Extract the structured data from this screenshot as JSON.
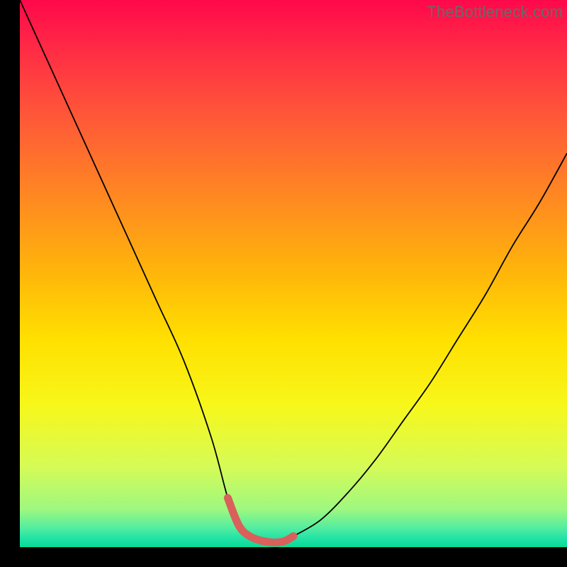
{
  "watermark": "TheBottleneck.com",
  "chart_data": {
    "type": "line",
    "title": "",
    "xlabel": "",
    "ylabel": "",
    "xlim": [
      0,
      100
    ],
    "ylim": [
      0,
      100
    ],
    "x": [
      0,
      5,
      10,
      15,
      20,
      25,
      30,
      35,
      38,
      40,
      42,
      45,
      48,
      50,
      55,
      60,
      65,
      70,
      75,
      80,
      85,
      90,
      95,
      100
    ],
    "values": [
      100,
      89,
      78,
      67,
      56,
      45,
      34,
      20,
      9,
      4,
      2,
      1,
      1,
      2,
      5,
      10,
      16,
      23,
      30,
      38,
      46,
      55,
      63,
      72
    ],
    "annotations": {
      "highlight_range_x": [
        38,
        50
      ],
      "highlight_color": "#d9605b",
      "background": "rainbow-gradient-vertical"
    }
  },
  "gradient_stops": [
    {
      "offset": 0.0,
      "color": "#ff084b"
    },
    {
      "offset": 0.1,
      "color": "#ff2f44"
    },
    {
      "offset": 0.22,
      "color": "#ff5a37"
    },
    {
      "offset": 0.35,
      "color": "#ff8523"
    },
    {
      "offset": 0.5,
      "color": "#ffb60a"
    },
    {
      "offset": 0.62,
      "color": "#ffe000"
    },
    {
      "offset": 0.74,
      "color": "#f7f71a"
    },
    {
      "offset": 0.85,
      "color": "#d7fb55"
    },
    {
      "offset": 0.93,
      "color": "#9ff87f"
    },
    {
      "offset": 0.965,
      "color": "#53eda0"
    },
    {
      "offset": 0.985,
      "color": "#1fe2a6"
    },
    {
      "offset": 1.0,
      "color": "#07db95"
    }
  ],
  "colors": {
    "curve": "#000000",
    "highlight": "#d9605b",
    "frame_bg": "#000000"
  }
}
